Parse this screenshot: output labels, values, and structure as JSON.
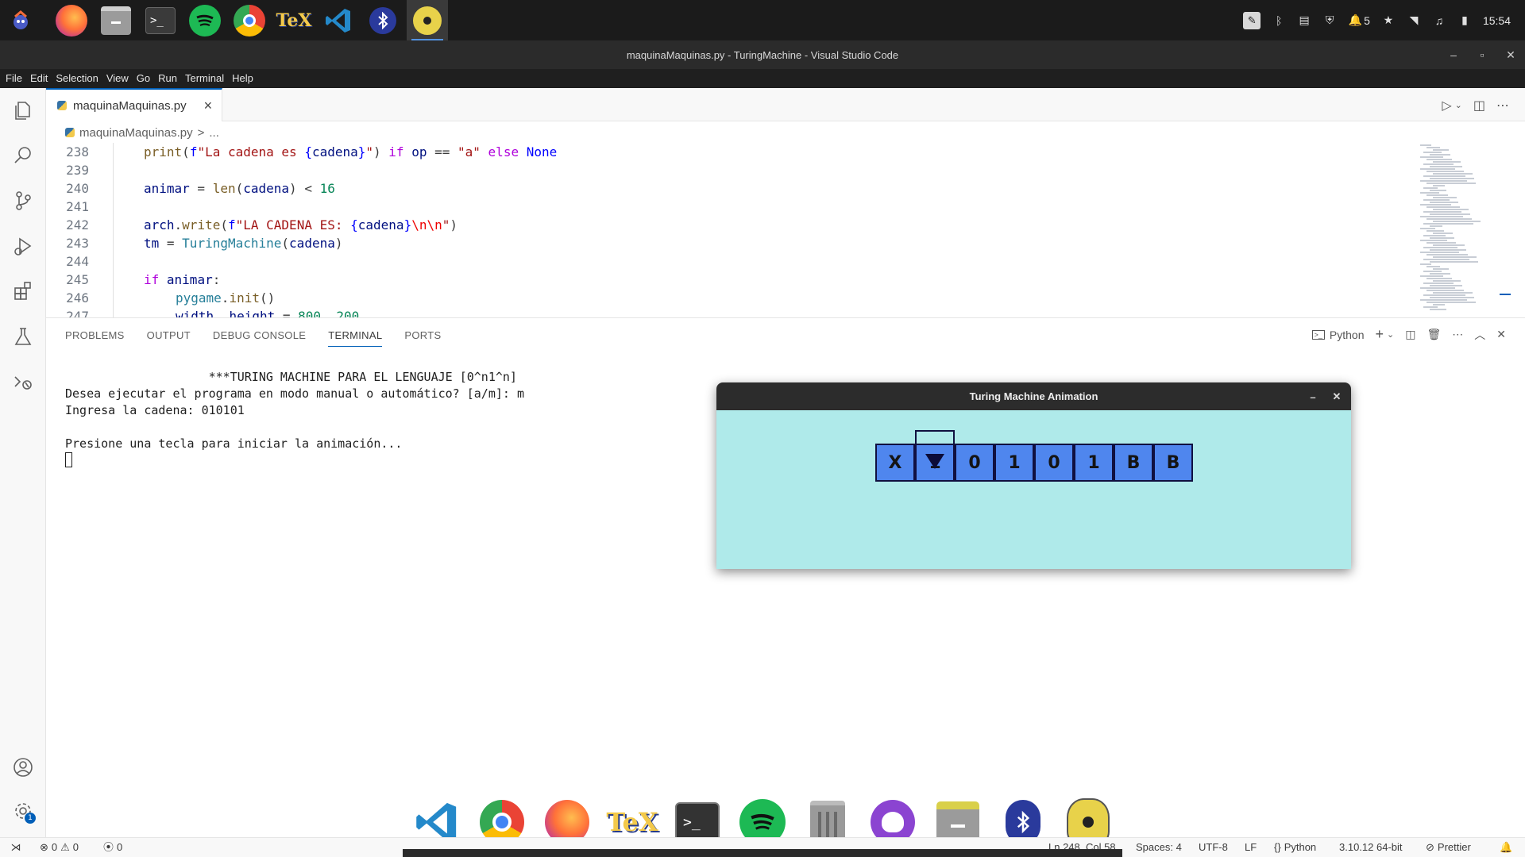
{
  "topbar": {
    "apps": [
      "app-menu",
      "firefox",
      "files",
      "terminal",
      "spotify",
      "chrome",
      "texstudio",
      "vscode",
      "bluetooth",
      "budgie"
    ],
    "tray": {
      "notifications": "5",
      "clock": "15:54"
    }
  },
  "window": {
    "title": "maquinaMaquinas.py - TuringMachine - Visual Studio Code"
  },
  "menu": [
    "File",
    "Edit",
    "Selection",
    "View",
    "Go",
    "Run",
    "Terminal",
    "Help"
  ],
  "tab": {
    "filename": "maquinaMaquinas.py"
  },
  "breadcrumb": {
    "file": "maquinaMaquinas.py",
    "sep": ">",
    "more": "..."
  },
  "code": {
    "lines": [
      {
        "n": "238",
        "text": "print(f\"La cadena es {cadena}\") if op == \"a\" else None"
      },
      {
        "n": "239",
        "text": ""
      },
      {
        "n": "240",
        "text": "animar = len(cadena) < 16"
      },
      {
        "n": "241",
        "text": ""
      },
      {
        "n": "242",
        "text": "arch.write(f\"LA CADENA ES: {cadena}\\n\\n\")"
      },
      {
        "n": "243",
        "text": "tm = TuringMachine(cadena)"
      },
      {
        "n": "244",
        "text": ""
      },
      {
        "n": "245",
        "text": "if animar:"
      },
      {
        "n": "246",
        "text": "    pygame.init()"
      },
      {
        "n": "247",
        "text": "    width, height = 800, 200"
      }
    ]
  },
  "panel": {
    "tabs": [
      "PROBLEMS",
      "OUTPUT",
      "DEBUG CONSOLE",
      "TERMINAL",
      "PORTS"
    ],
    "active_tab": "TERMINAL",
    "shell": "Python",
    "terminal_lines": [
      "                    ***TURING MACHINE PARA EL LENGUAJE [0^n1^n]",
      "Desea ejecutar el programa en modo manual o automático? [a/m]: m",
      "Ingresa la cadena: 010101",
      "",
      "Presione una tecla para iniciar la animación..."
    ]
  },
  "pygame": {
    "title": "Turing Machine Animation",
    "tape": [
      "X",
      "1",
      "0",
      "1",
      "0",
      "1",
      "B",
      "B"
    ],
    "head_index": 1,
    "bg_color": "#afeaea",
    "cell_color": "#4f86ee"
  },
  "dock": {
    "apps": [
      "vscode",
      "chrome",
      "firefox",
      "texstudio",
      "terminal",
      "spotify",
      "trash",
      "github",
      "files",
      "bluetooth",
      "budgie"
    ]
  },
  "statusbar": {
    "errors": "0",
    "warnings": "0",
    "ports": "0",
    "position": "Ln 248, Col 58",
    "spaces": "Spaces: 4",
    "encoding": "UTF-8",
    "eol": "LF",
    "language": "Python",
    "interpreter": "3.10.12 64-bit",
    "formatter": "Prettier"
  }
}
